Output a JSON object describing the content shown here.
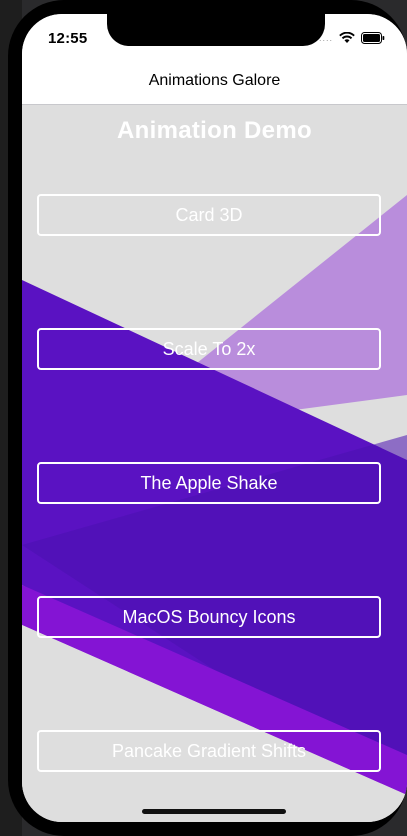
{
  "status_bar": {
    "time": "12:55",
    "signal_dots": "....",
    "wifi_icon": "wifi-icon",
    "battery_icon": "battery-icon"
  },
  "nav": {
    "title": "Animations Galore"
  },
  "main": {
    "heading": "Animation Demo",
    "buttons": [
      {
        "label": "Card 3D"
      },
      {
        "label": "Scale To 2x"
      },
      {
        "label": "The Apple Shake"
      },
      {
        "label": "MacOS Bouncy Icons"
      },
      {
        "label": "Pancake Gradient Shifts"
      }
    ]
  },
  "colors": {
    "background": "#dedede",
    "purple_dark": "#5a12c2",
    "purple_light": "#b98ddc",
    "purple_bright": "#8414d4",
    "button_border": "#ffffff"
  }
}
